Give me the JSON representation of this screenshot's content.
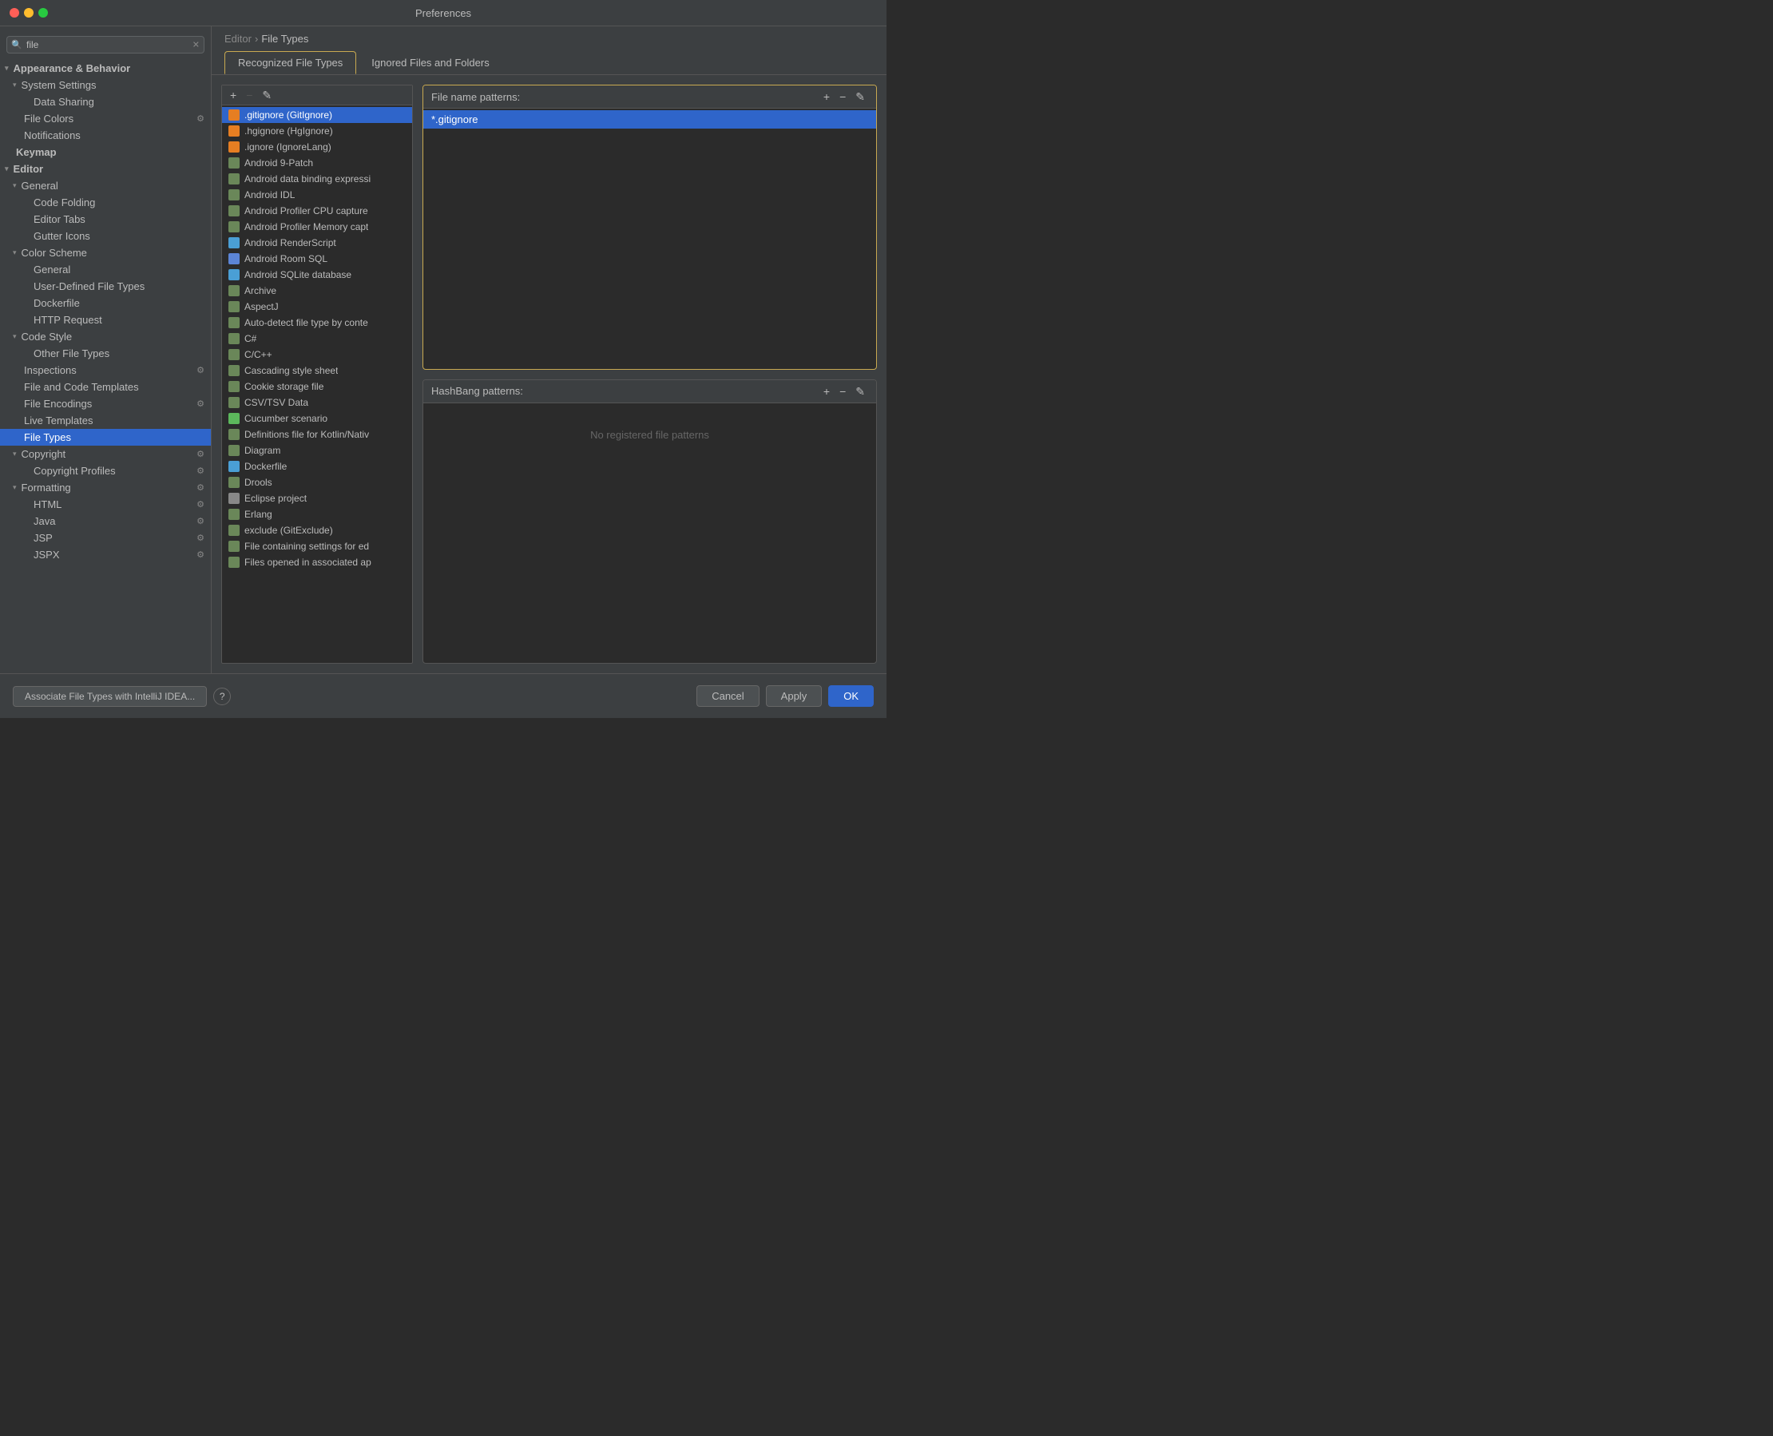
{
  "titleBar": {
    "title": "Preferences"
  },
  "breadcrumb": {
    "parent": "Editor",
    "separator": "›",
    "current": "File Types"
  },
  "search": {
    "placeholder": "file",
    "value": "file"
  },
  "sidebar": {
    "sections": [
      {
        "id": "appearance",
        "label": "Appearance & Behavior",
        "expanded": true,
        "indent": "category"
      },
      {
        "id": "system-settings",
        "label": "System Settings",
        "expanded": true,
        "indent": "sub"
      },
      {
        "id": "data-sharing",
        "label": "Data Sharing",
        "indent": "sub2"
      },
      {
        "id": "file-colors",
        "label": "File Colors",
        "indent": "sub",
        "badge": true
      },
      {
        "id": "notifications",
        "label": "Notifications",
        "indent": "sub"
      },
      {
        "id": "keymap",
        "label": "Keymap",
        "indent": "root"
      },
      {
        "id": "editor",
        "label": "Editor",
        "expanded": true,
        "indent": "category"
      },
      {
        "id": "general",
        "label": "General",
        "expanded": true,
        "indent": "sub"
      },
      {
        "id": "code-folding",
        "label": "Code Folding",
        "indent": "sub2"
      },
      {
        "id": "editor-tabs",
        "label": "Editor Tabs",
        "indent": "sub2"
      },
      {
        "id": "gutter-icons",
        "label": "Gutter Icons",
        "indent": "sub2"
      },
      {
        "id": "color-scheme",
        "label": "Color Scheme",
        "expanded": true,
        "indent": "sub"
      },
      {
        "id": "cs-general",
        "label": "General",
        "indent": "sub2"
      },
      {
        "id": "user-defined-file-types",
        "label": "User-Defined File Types",
        "indent": "sub2"
      },
      {
        "id": "dockerfile",
        "label": "Dockerfile",
        "indent": "sub2"
      },
      {
        "id": "http-request",
        "label": "HTTP Request",
        "indent": "sub2"
      },
      {
        "id": "code-style",
        "label": "Code Style",
        "expanded": true,
        "indent": "sub"
      },
      {
        "id": "other-file-types",
        "label": "Other File Types",
        "indent": "sub2"
      },
      {
        "id": "inspections",
        "label": "Inspections",
        "indent": "sub",
        "badge": true
      },
      {
        "id": "file-and-code-templates",
        "label": "File and Code Templates",
        "indent": "sub"
      },
      {
        "id": "file-encodings",
        "label": "File Encodings",
        "indent": "sub",
        "badge": true
      },
      {
        "id": "live-templates",
        "label": "Live Templates",
        "indent": "sub"
      },
      {
        "id": "file-types",
        "label": "File Types",
        "indent": "sub",
        "selected": true
      },
      {
        "id": "copyright",
        "label": "Copyright",
        "expanded": true,
        "indent": "sub",
        "badge": true
      },
      {
        "id": "copyright-profiles",
        "label": "Copyright Profiles",
        "indent": "sub2",
        "badge": true
      },
      {
        "id": "formatting",
        "label": "Formatting",
        "expanded": true,
        "indent": "sub",
        "badge": true
      },
      {
        "id": "fmt-html",
        "label": "HTML",
        "indent": "sub2",
        "badge": true
      },
      {
        "id": "fmt-java",
        "label": "Java",
        "indent": "sub2",
        "badge": true
      },
      {
        "id": "fmt-jsp",
        "label": "JSP",
        "indent": "sub2",
        "badge": true
      },
      {
        "id": "fmt-jspx",
        "label": "JSPX",
        "indent": "sub2",
        "badge": true
      }
    ]
  },
  "tabs": [
    {
      "id": "recognized",
      "label": "Recognized File Types",
      "active": true
    },
    {
      "id": "ignored",
      "label": "Ignored Files and Folders",
      "active": false
    }
  ],
  "fileTypes": [
    {
      "id": "gitignore",
      "label": ".gitignore (GitIgnore)",
      "selected": true,
      "iconColor": "#888",
      "iconChar": "🔧"
    },
    {
      "id": "hgignore",
      "label": ".hgignore (HgIgnore)",
      "iconColor": "#888",
      "iconChar": "🔧"
    },
    {
      "id": "ignore",
      "label": ".ignore (IgnoreLang)",
      "iconColor": "#888",
      "iconChar": "🔧"
    },
    {
      "id": "android-9patch",
      "label": "Android 9-Patch",
      "iconColor": "#888",
      "iconChar": "📄"
    },
    {
      "id": "android-databinding",
      "label": "Android data binding expressi",
      "iconColor": "#888",
      "iconChar": "📄"
    },
    {
      "id": "android-idl",
      "label": "Android IDL",
      "iconColor": "#888",
      "iconChar": "📄"
    },
    {
      "id": "android-profiler-cpu",
      "label": "Android Profiler CPU capture",
      "iconColor": "#888",
      "iconChar": "📄"
    },
    {
      "id": "android-profiler-mem",
      "label": "Android Profiler Memory capt",
      "iconColor": "#888",
      "iconChar": "📄"
    },
    {
      "id": "android-renderscript",
      "label": "Android RenderScript",
      "iconColor": "#888",
      "iconChar": "🔵"
    },
    {
      "id": "android-room-sql",
      "label": "Android Room SQL",
      "iconColor": "#888",
      "iconChar": "📋"
    },
    {
      "id": "android-sqlite",
      "label": "Android SQLite database",
      "iconColor": "#4a90d9",
      "iconChar": "📝"
    },
    {
      "id": "archive",
      "label": "Archive",
      "iconColor": "#888",
      "iconChar": "📦"
    },
    {
      "id": "aspectj",
      "label": "AspectJ",
      "iconColor": "#888",
      "iconChar": "☕"
    },
    {
      "id": "auto-detect",
      "label": "Auto-detect file type by conte",
      "iconColor": "#888",
      "iconChar": "🔍"
    },
    {
      "id": "csharp",
      "label": "C#",
      "iconColor": "#888",
      "iconChar": "📄"
    },
    {
      "id": "cpp",
      "label": "C/C++",
      "iconColor": "#888",
      "iconChar": "📄"
    },
    {
      "id": "css",
      "label": "Cascading style sheet",
      "iconColor": "#888",
      "iconChar": "📄"
    },
    {
      "id": "cookie-storage",
      "label": "Cookie storage file",
      "iconColor": "#888",
      "iconChar": "📋"
    },
    {
      "id": "csv-tsv",
      "label": "CSV/TSV Data",
      "iconColor": "#888",
      "iconChar": "📋"
    },
    {
      "id": "cucumber",
      "label": "Cucumber scenario",
      "iconColor": "#5cb85c",
      "iconChar": "🥒"
    },
    {
      "id": "kotlin-native",
      "label": "Definitions file for Kotlin/Nativ",
      "iconColor": "#888",
      "iconChar": "📝"
    },
    {
      "id": "diagram",
      "label": "Diagram",
      "iconColor": "#888",
      "iconChar": "📋"
    },
    {
      "id": "dockerfile2",
      "label": "Dockerfile",
      "iconColor": "#888",
      "iconChar": "🐋"
    },
    {
      "id": "drools",
      "label": "Drools",
      "iconColor": "#888",
      "iconChar": "📄"
    },
    {
      "id": "eclipse-project",
      "label": "Eclipse project",
      "iconColor": "#888",
      "iconChar": "🌑"
    },
    {
      "id": "erlang",
      "label": "Erlang",
      "iconColor": "#888",
      "iconChar": "📄"
    },
    {
      "id": "gitexclude",
      "label": "exclude (GitExclude)",
      "iconColor": "#888",
      "iconChar": "🔧"
    },
    {
      "id": "editor-settings",
      "label": "File containing settings for ed",
      "iconColor": "#888",
      "iconChar": "⚙️"
    },
    {
      "id": "files-associated",
      "label": "Files opened in associated ap",
      "iconColor": "#888",
      "iconChar": "⚙️"
    }
  ],
  "fileNamePatterns": {
    "label": "File name patterns:",
    "items": [
      {
        "id": "gitignore-pattern",
        "label": "*.gitignore",
        "selected": true
      }
    ]
  },
  "hashbangPatterns": {
    "label": "HashBang patterns:",
    "noPatterns": "No registered file patterns"
  },
  "bottomBar": {
    "associateButton": "Associate File Types with IntelliJ IDEA...",
    "cancelButton": "Cancel",
    "applyButton": "Apply",
    "okButton": "OK"
  }
}
